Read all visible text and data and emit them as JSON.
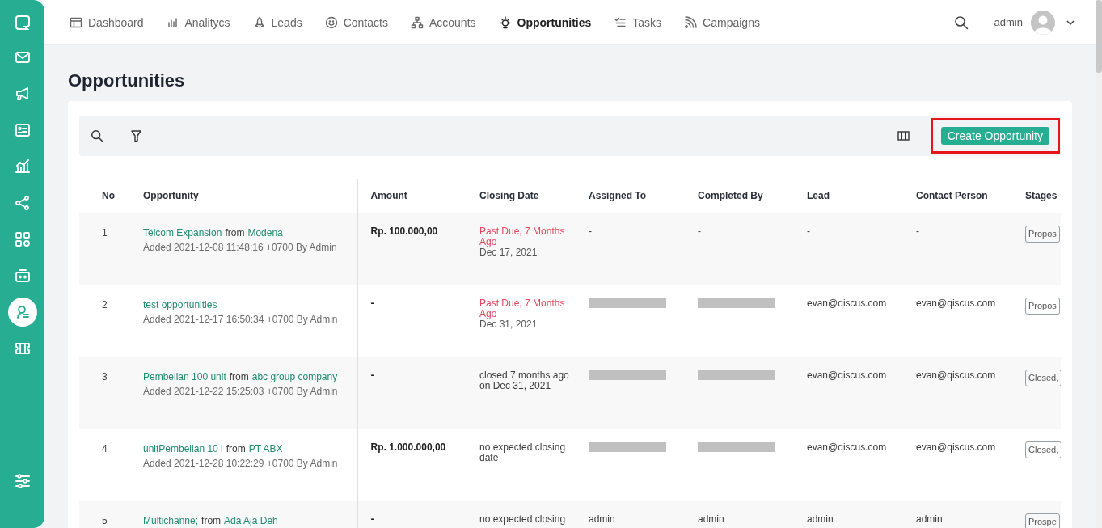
{
  "sidebar": {
    "items": [
      {
        "selected": false
      },
      {
        "selected": false
      },
      {
        "selected": false
      },
      {
        "selected": false
      },
      {
        "selected": false
      },
      {
        "selected": false
      },
      {
        "selected": false
      },
      {
        "selected": true
      },
      {
        "selected": false
      }
    ]
  },
  "nav": {
    "items": [
      {
        "label": "Dashboard",
        "selected": false
      },
      {
        "label": "Analitycs",
        "selected": false
      },
      {
        "label": "Leads",
        "selected": false
      },
      {
        "label": "Contacts",
        "selected": false
      },
      {
        "label": "Accounts",
        "selected": false
      },
      {
        "label": "Opportunities",
        "selected": true
      },
      {
        "label": "Tasks",
        "selected": false
      },
      {
        "label": "Campaigns",
        "selected": false
      }
    ],
    "user": "admin"
  },
  "page_title": "Opportunities",
  "toolbar": {
    "create_button": {
      "label": "Create Opportunity",
      "highlighted": true
    }
  },
  "table": {
    "columns": [
      "No",
      "Opportunity",
      "Amount",
      "Closing Date",
      "Assigned To",
      "Completed By",
      "Lead",
      "Contact Person",
      "Stages"
    ],
    "rows": [
      {
        "no": "1",
        "opportunity": {
          "name": "Telcom Expansion",
          "connector": "from",
          "company": "Modena"
        },
        "added": "Added 2021-12-08 11:48:16 +0700 By Admin",
        "amount": "Rp. 100.000,00",
        "closing": {
          "kind": "past_due",
          "status": "Past Due, 7 Months Ago",
          "date": "Dec 17, 2021"
        },
        "assigned_to": {
          "kind": "text",
          "text": "-"
        },
        "completed_by": {
          "kind": "text",
          "text": "-"
        },
        "lead": "-",
        "contact_person": "-",
        "stage": "Propos"
      },
      {
        "no": "2",
        "opportunity": {
          "name": "test opportunities"
        },
        "added": "Added 2021-12-17 16:50:34 +0700 By Admin",
        "amount": "-",
        "closing": {
          "kind": "past_due",
          "status": "Past Due, 7 Months Ago",
          "date": "Dec 31, 2021"
        },
        "assigned_to": {
          "kind": "redacted"
        },
        "completed_by": {
          "kind": "redacted"
        },
        "lead": "evan@qiscus.com",
        "contact_person": "evan@qiscus.com",
        "stage": "Propos"
      },
      {
        "no": "3",
        "opportunity": {
          "name": "Pembelian 100 unit",
          "connector": "from",
          "company": "abc group company"
        },
        "added": "Added 2021-12-22 15:25:03 +0700 By Admin",
        "amount": "-",
        "closing": {
          "kind": "plain",
          "status": "closed 7 months ago on Dec 31, 2021"
        },
        "assigned_to": {
          "kind": "redacted"
        },
        "completed_by": {
          "kind": "redacted"
        },
        "lead": "evan@qiscus.com",
        "contact_person": "evan@qiscus.com",
        "stage": "Closed,"
      },
      {
        "no": "4",
        "opportunity": {
          "name": "unitPembelian 10 l",
          "connector": "from",
          "company": "PT ABX"
        },
        "added": "Added 2021-12-28 10:22:29 +0700 By Admin",
        "amount": "Rp. 1.000.000,00",
        "closing": {
          "kind": "plain",
          "status": "no expected closing date"
        },
        "assigned_to": {
          "kind": "redacted"
        },
        "completed_by": {
          "kind": "redacted"
        },
        "lead": "evan@qiscus.com",
        "contact_person": "evan@qiscus.com",
        "stage": "Closed,"
      },
      {
        "no": "5",
        "opportunity": {
          "name": "Multichanne;",
          "connector": "from",
          "company": "Ada Aja Deh"
        },
        "amount": "-",
        "closing": {
          "kind": "plain",
          "status": "no expected closing"
        },
        "assigned_to": {
          "kind": "text",
          "text": "admin"
        },
        "completed_by": {
          "kind": "text",
          "text": "admin"
        },
        "lead": "admin",
        "contact_person": "admin",
        "stage": "Prospe"
      }
    ]
  }
}
